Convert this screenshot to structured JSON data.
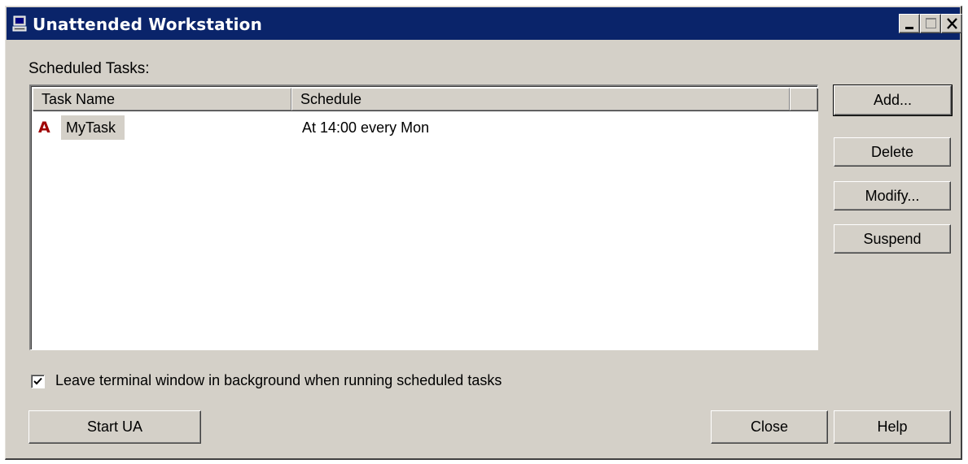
{
  "window": {
    "title": "Unattended Workstation",
    "title_icon": "monitor-icon",
    "controls": [
      "minimize-icon",
      "maximize-icon",
      "close-icon"
    ]
  },
  "scheduled_label": "Scheduled Tasks:",
  "list": {
    "columns": [
      "Task Name",
      "Schedule"
    ],
    "rows": [
      {
        "icon": "A",
        "name": "MyTask",
        "schedule": "At 14:00 every Mon"
      }
    ]
  },
  "side_buttons": {
    "add": "Add...",
    "delete": "Delete",
    "modify": "Modify...",
    "suspend": "Suspend"
  },
  "checkbox": {
    "checked": true,
    "label": "Leave terminal window in background when running scheduled tasks"
  },
  "bottom_buttons": {
    "start_ua": "Start UA",
    "close": "Close",
    "help": "Help"
  },
  "colors": {
    "titlebar": "#0a246a",
    "face": "#d4d0c8",
    "task_icon": "#a00000"
  }
}
